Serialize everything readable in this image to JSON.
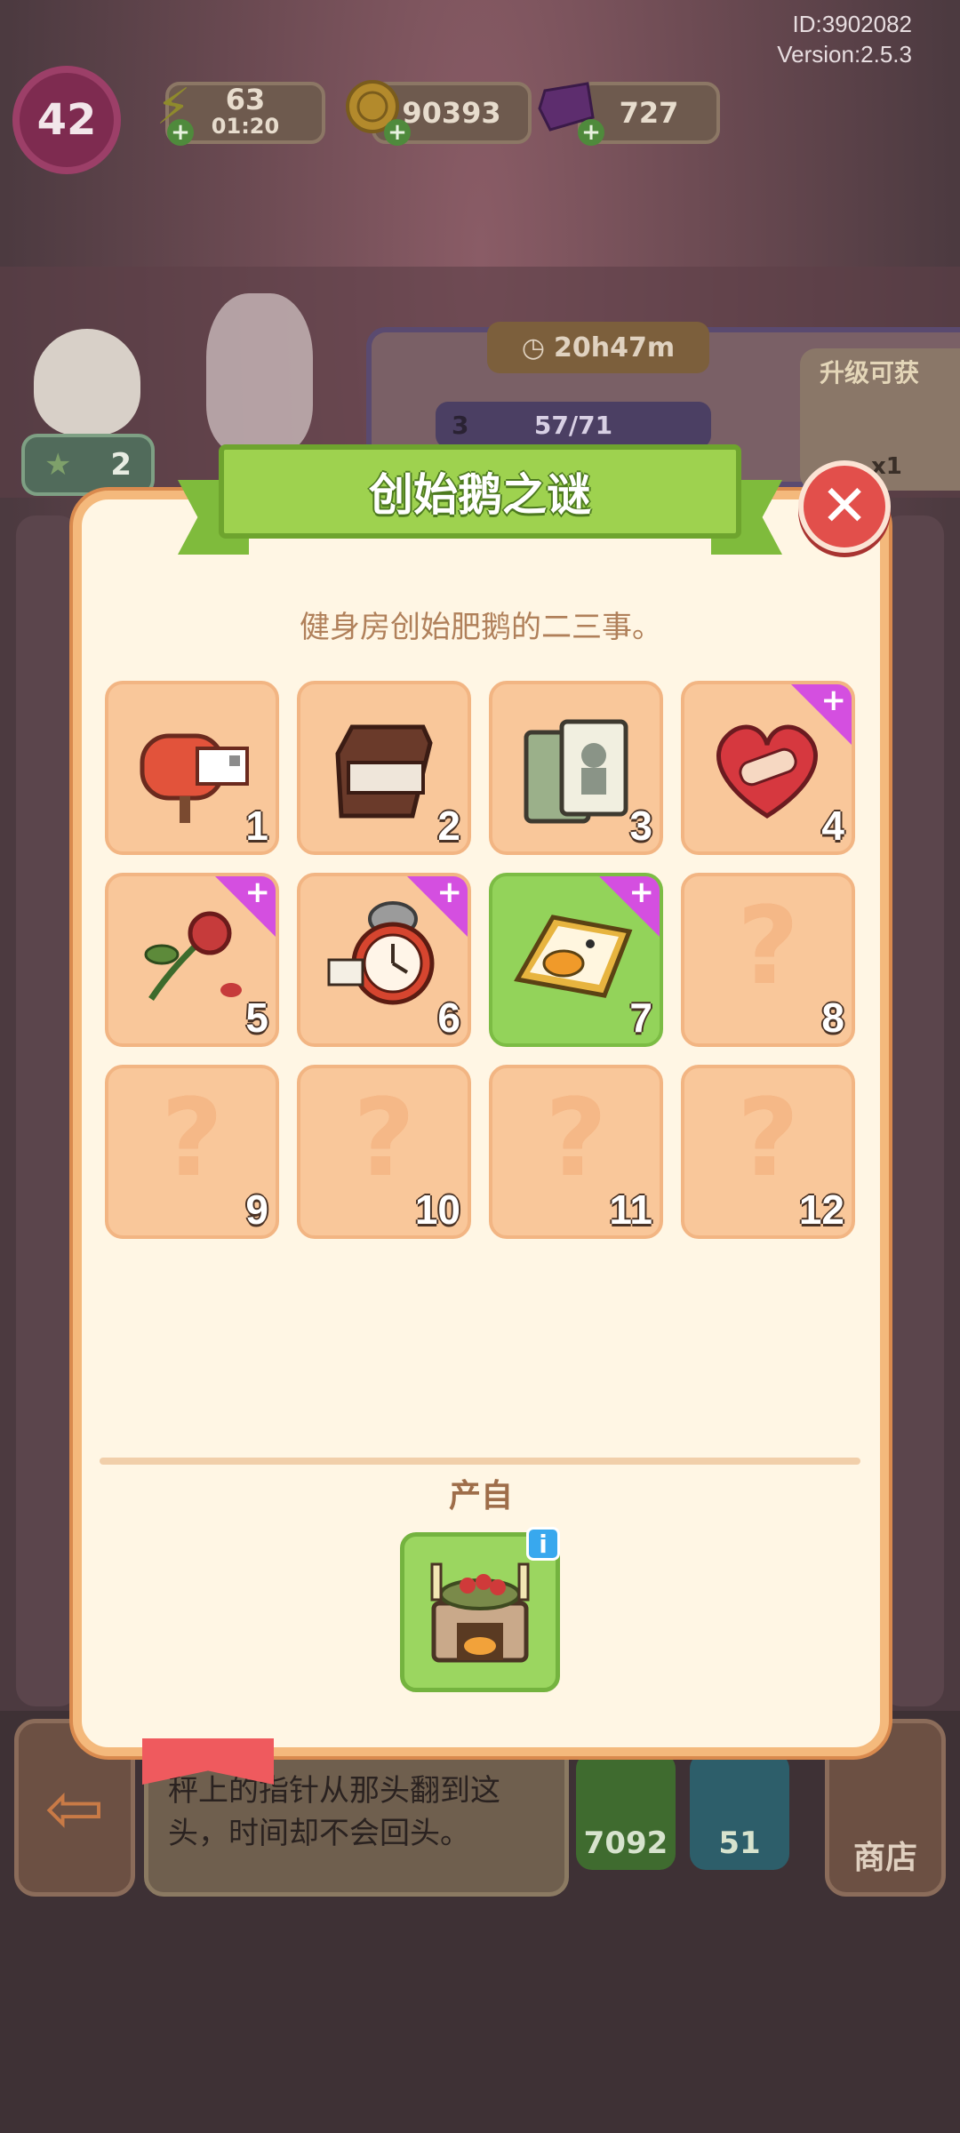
{
  "header": {
    "id_label": "ID:3902082",
    "version_label": "Version:2.5.3",
    "level": "42",
    "energy": "63",
    "energy_timer": "01:20",
    "coins": "90393",
    "gems": "727"
  },
  "background": {
    "goose_count": "2",
    "task_timer": "20h47m",
    "task_progress": "57/71",
    "task_level": "3",
    "upgrade_label": "升级可获",
    "upgrade_reward_count": "x1",
    "item_description": "秤上的指针从那头翻到这头，时间却不会回头。",
    "gem_price": "7092",
    "coin_price": "51",
    "shop_label": "商店"
  },
  "modal": {
    "title": "创始鹅之谜",
    "subtitle": "健身房创始肥鹅的二三事。",
    "close_icon": "close-icon",
    "source_label": "产自",
    "source_item_icon": "fireplace-cake-icon",
    "info_badge": "i",
    "new_badge": "+",
    "question_mark": "?",
    "slots": [
      {
        "number": "1",
        "icon": "mailbox-icon",
        "unlocked": true,
        "new": false,
        "selected": false
      },
      {
        "number": "2",
        "icon": "chocolate-bar-icon",
        "unlocked": true,
        "new": false,
        "selected": false
      },
      {
        "number": "3",
        "icon": "fitness-magazine-icon",
        "unlocked": true,
        "new": false,
        "selected": false
      },
      {
        "number": "4",
        "icon": "bandaged-heart-icon",
        "unlocked": true,
        "new": true,
        "selected": false
      },
      {
        "number": "5",
        "icon": "wilted-rose-icon",
        "unlocked": true,
        "new": true,
        "selected": false
      },
      {
        "number": "6",
        "icon": "alarm-clock-icon",
        "unlocked": true,
        "new": true,
        "selected": false
      },
      {
        "number": "7",
        "icon": "goose-scale-icon",
        "unlocked": true,
        "new": true,
        "selected": true
      },
      {
        "number": "8",
        "icon": "question-mark-icon",
        "unlocked": false,
        "new": false,
        "selected": false
      },
      {
        "number": "9",
        "icon": "question-mark-icon",
        "unlocked": false,
        "new": false,
        "selected": false
      },
      {
        "number": "10",
        "icon": "question-mark-icon",
        "unlocked": false,
        "new": false,
        "selected": false
      },
      {
        "number": "11",
        "icon": "question-mark-icon",
        "unlocked": false,
        "new": false,
        "selected": false
      },
      {
        "number": "12",
        "icon": "question-mark-icon",
        "unlocked": false,
        "new": false,
        "selected": false
      }
    ]
  },
  "colors": {
    "modal_bg": "#fff6e4",
    "modal_border": "#f4b97c",
    "slot_bg": "#f9c79a",
    "slot_selected": "#93d35a",
    "ribbon": "#9ed24f",
    "close_button": "#e24f4b",
    "new_badge": "#d44fe0"
  }
}
